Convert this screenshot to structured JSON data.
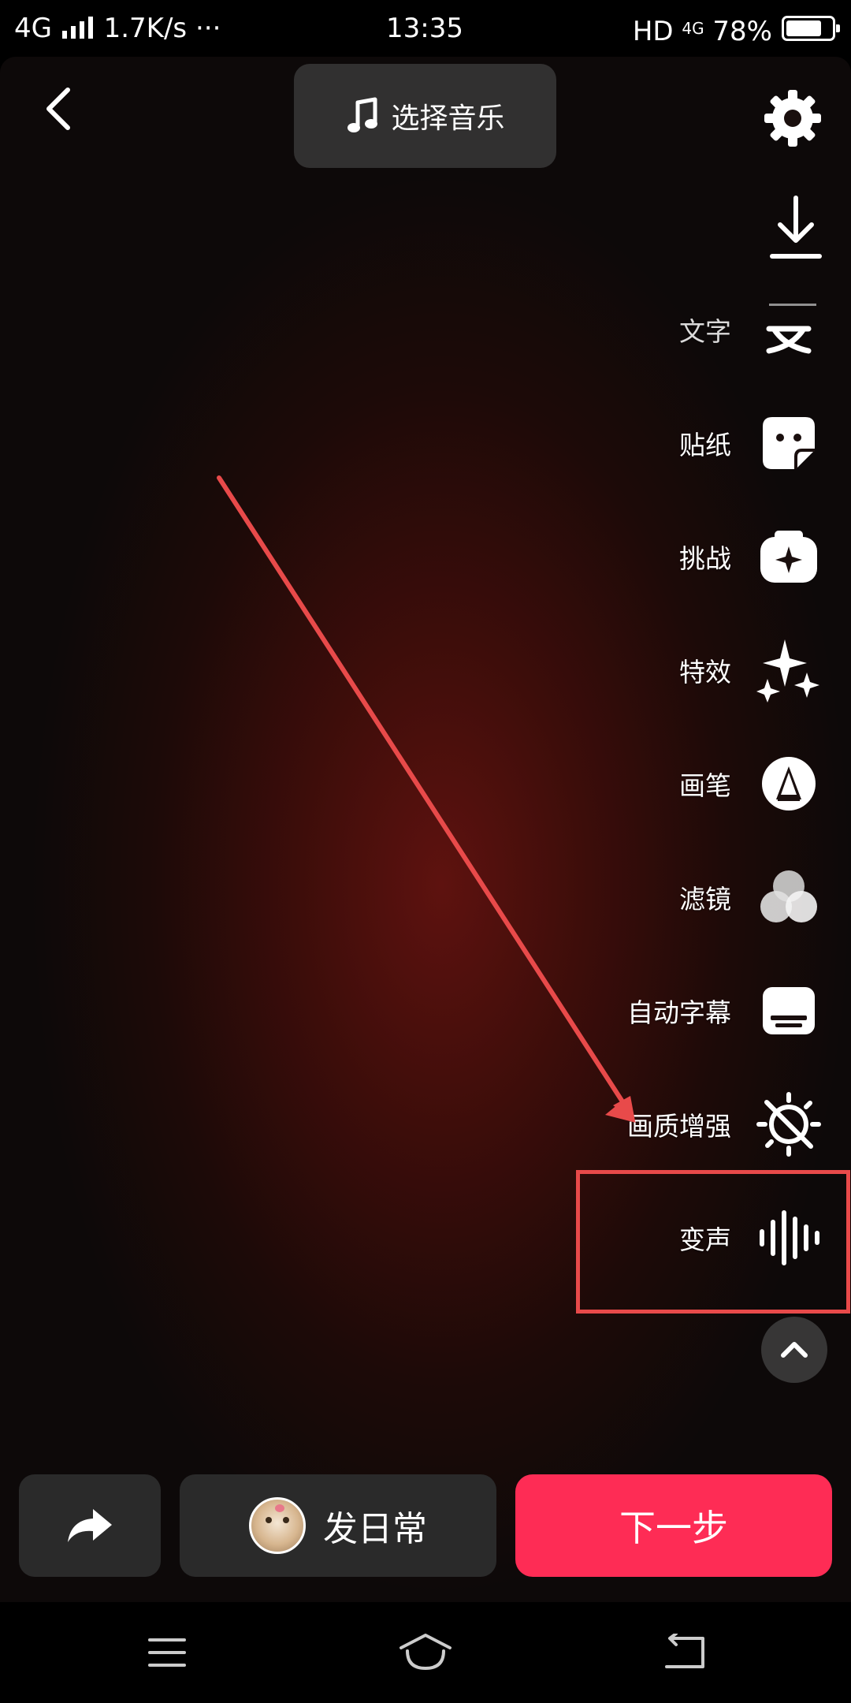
{
  "status_bar": {
    "network": "4G",
    "speed": "1.7K/s ···",
    "time": "13:35",
    "hd_label": "HD",
    "network_right": "4G",
    "battery": "78%",
    "battery_level": 0.78
  },
  "top_bar": {
    "music_label": "选择音乐"
  },
  "tools": [
    {
      "label": "文字",
      "icon": "text-icon"
    },
    {
      "label": "贴纸",
      "icon": "sticker-icon"
    },
    {
      "label": "挑战",
      "icon": "challenge-icon"
    },
    {
      "label": "特效",
      "icon": "sparkle-icon"
    },
    {
      "label": "画笔",
      "icon": "brush-icon"
    },
    {
      "label": "滤镜",
      "icon": "filter-icon"
    },
    {
      "label": "自动字幕",
      "icon": "subtitle-icon"
    },
    {
      "label": "画质增强",
      "icon": "enhance-icon"
    },
    {
      "label": "变声",
      "icon": "voice-change-icon"
    }
  ],
  "bottom_bar": {
    "daily_label": "发日常",
    "next_label": "下一步"
  },
  "colors": {
    "accent": "#fe2c55",
    "annotation": "#e84a4a"
  }
}
